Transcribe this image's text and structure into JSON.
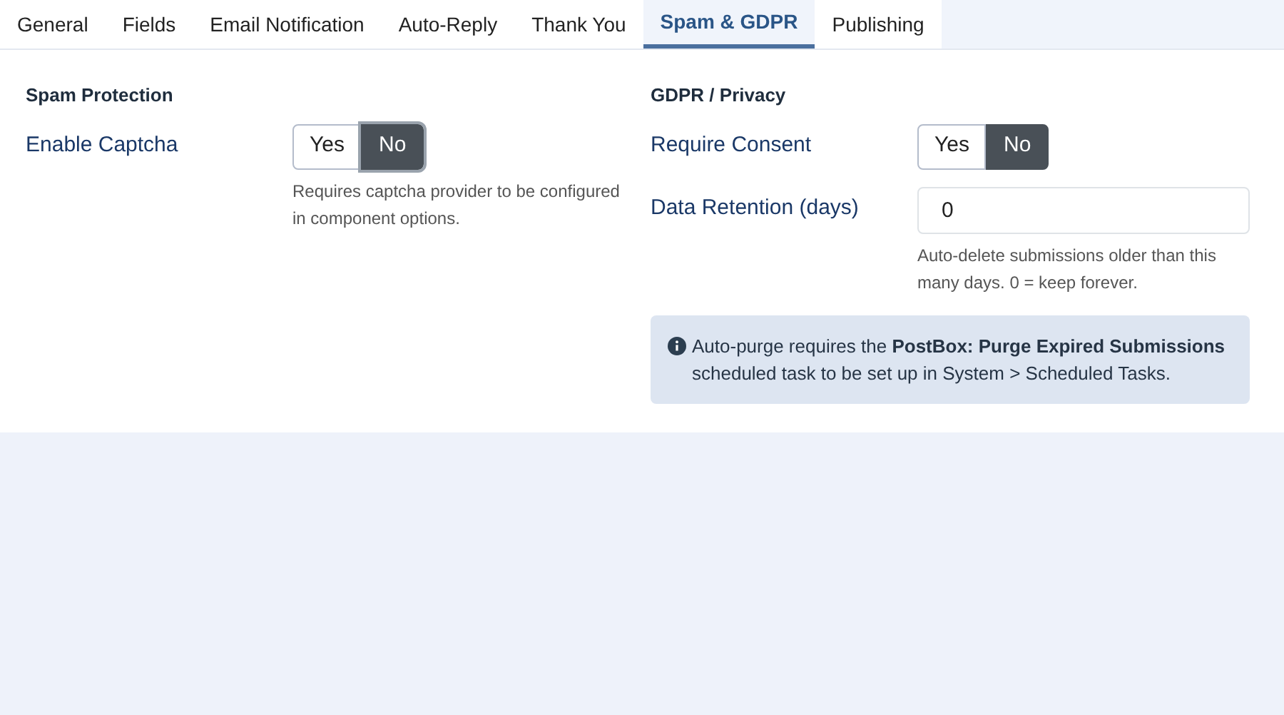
{
  "tabs": [
    {
      "label": "General",
      "selected": false
    },
    {
      "label": "Fields",
      "selected": false
    },
    {
      "label": "Email Notification",
      "selected": false
    },
    {
      "label": "Auto-Reply",
      "selected": false
    },
    {
      "label": "Thank You",
      "selected": false
    },
    {
      "label": "Spam & GDPR",
      "selected": true
    },
    {
      "label": "Publishing",
      "selected": false
    }
  ],
  "sections": [
    {
      "title": "Spam Protection",
      "fields": [
        {
          "kind": "toggle",
          "label": "Enable Captcha",
          "options": [
            {
              "label": "Yes",
              "selected": false,
              "focused": false
            },
            {
              "label": "No",
              "selected": true,
              "focused": true
            }
          ],
          "help": "Requires captcha provider to be configured in component options."
        }
      ]
    },
    {
      "title": "GDPR / Privacy",
      "fields": [
        {
          "kind": "toggle",
          "label": "Require Consent",
          "options": [
            {
              "label": "Yes",
              "selected": false,
              "focused": false
            },
            {
              "label": "No",
              "selected": true,
              "focused": false
            }
          ]
        },
        {
          "kind": "number",
          "label": "Data Retention (days)",
          "value": "0",
          "help": "Auto-delete submissions older than this many days. 0 = keep forever."
        }
      ],
      "notice": "Auto-purge requires the **PostBox: Purge Expired Submissions** scheduled task to be set up in System > Scheduled Tasks."
    }
  ]
}
